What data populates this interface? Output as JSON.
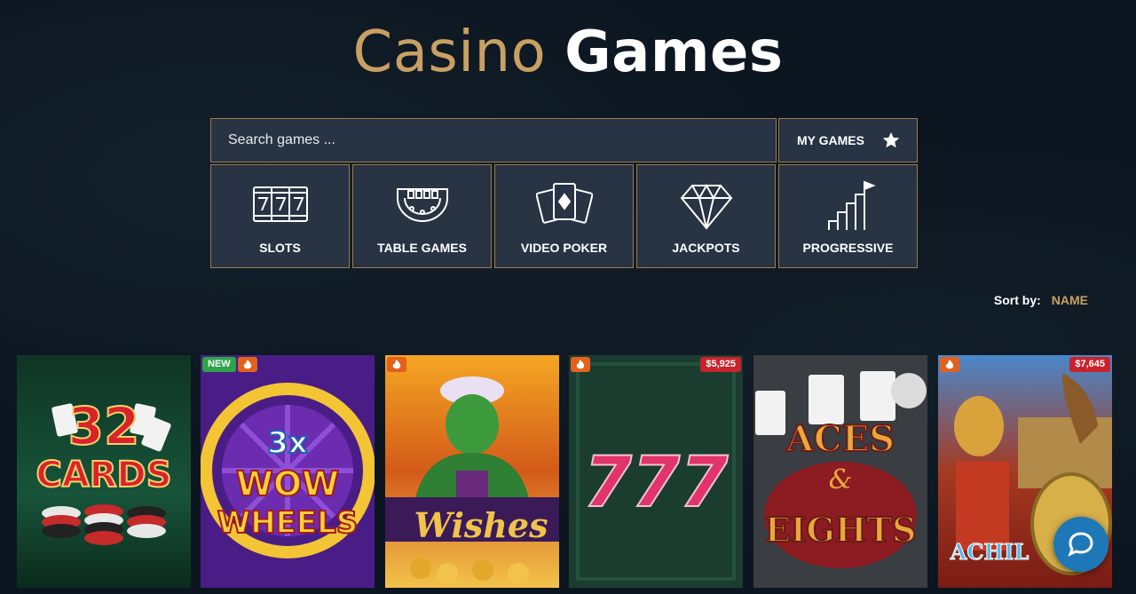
{
  "title": {
    "part1": "Casino",
    "part2": "Games"
  },
  "search": {
    "placeholder": "Search games ..."
  },
  "my_games": {
    "label": "MY GAMES",
    "icon": "star-icon"
  },
  "categories": [
    {
      "label": "SLOTS",
      "icon": "slot-reels-icon"
    },
    {
      "label": "TABLE GAMES",
      "icon": "card-table-icon"
    },
    {
      "label": "VIDEO POKER",
      "icon": "playing-cards-icon"
    },
    {
      "label": "JACKPOTS",
      "icon": "diamond-icon"
    },
    {
      "label": "PROGRESSIVE",
      "icon": "stairs-flag-icon"
    }
  ],
  "sort": {
    "label": "Sort by:",
    "value": "NAME"
  },
  "games": [
    {
      "art_text": "32 CARDS",
      "badges": []
    },
    {
      "art_text": "3x WOW WHEELS",
      "badges": [
        "NEW",
        "hot"
      ]
    },
    {
      "art_text": "Wishes",
      "badges": [
        "hot"
      ]
    },
    {
      "art_text": "777",
      "badges": [
        "hot"
      ],
      "jackpot": "$5,925"
    },
    {
      "art_text": "ACES & EIGHTS",
      "badges": []
    },
    {
      "art_text": "ACHIL",
      "badges": [
        "hot"
      ],
      "jackpot": "$7,645"
    }
  ],
  "badges": {
    "new": "NEW"
  },
  "colors": {
    "gold": "#c9a063",
    "panel": "#283343",
    "border": "#9e7d48",
    "background": "#0c1620",
    "hot": "#e2611d",
    "new": "#2fa34a",
    "jackpot": "#c8232c",
    "chat": "#1e78b8"
  },
  "chat": {
    "icon": "chat-bubble-icon"
  }
}
